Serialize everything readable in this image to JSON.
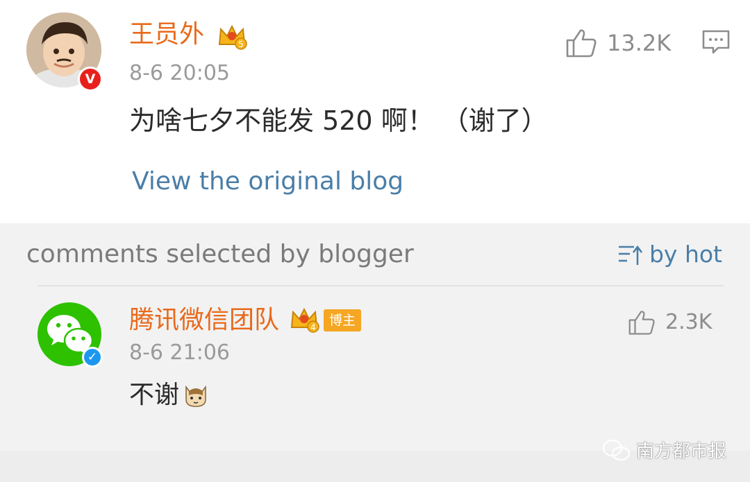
{
  "post": {
    "author_name": "王员外",
    "timestamp": "8-6 20:05",
    "like_count": "13.2K",
    "body_text": "为啥七夕不能发 520 啊！ （谢了）",
    "view_original_label": "View the original blog",
    "verified_badge": "V",
    "crown_level": "5"
  },
  "comments_section": {
    "title": "comments selected by blogger",
    "sort_label": "by hot"
  },
  "comments": [
    {
      "author_name": "腾讯微信团队",
      "crown_level": "4",
      "role_tag": "博主",
      "timestamp": "8-6 21:06",
      "text": "不谢",
      "like_count": "2.3K",
      "verified_badge": "✓"
    }
  ],
  "watermark": {
    "text": "南方都市报"
  },
  "colors": {
    "name": "#e8691a",
    "link": "#4a7ea8",
    "verified_red": "#e8201c",
    "verified_blue": "#1c97f0",
    "wechat_green": "#2dc100"
  },
  "icons": [
    "like-icon",
    "comment-icon",
    "sort-icon",
    "crown-icon",
    "cat-emoji-icon",
    "wechat-logo-icon"
  ]
}
